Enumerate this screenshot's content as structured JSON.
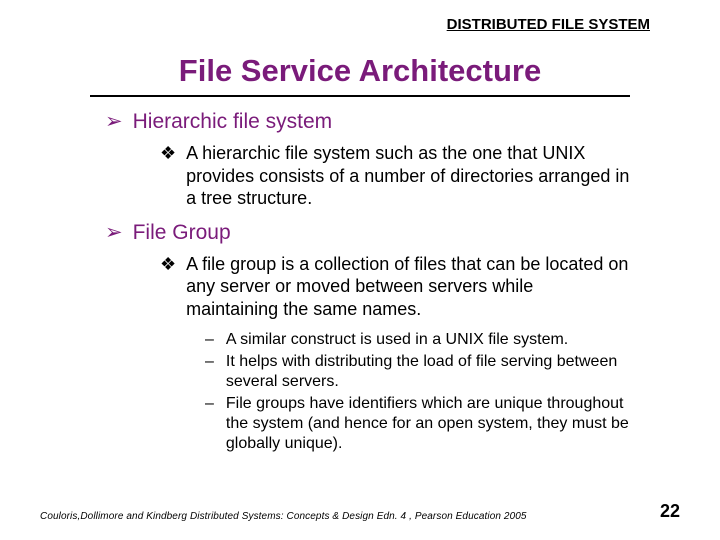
{
  "header_label": "DISTRIBUTED FILE SYSTEM",
  "title": "File Service Architecture",
  "sections": {
    "s0": {
      "heading": "Hierarchic file system",
      "body0": "A hierarchic file system such as the one that UNIX provides consists of a number of directories arranged in a tree structure."
    },
    "s1": {
      "heading": "File Group",
      "body0": "A file group is a collection of files that can be located on any server or moved between servers while maintaining the same names.",
      "sub0": "A similar construct is used in a UNIX file system.",
      "sub1": "It helps with distributing the load of file serving between several servers.",
      "sub2": "File groups have identifiers which are unique throughout the system (and hence for an open system, they must be globally unique)."
    }
  },
  "footer": {
    "citation": "Couloris,Dollimore and Kindberg  Distributed Systems: Concepts & Design  Edn. 4 ,  Pearson Education 2005",
    "page": "22"
  }
}
